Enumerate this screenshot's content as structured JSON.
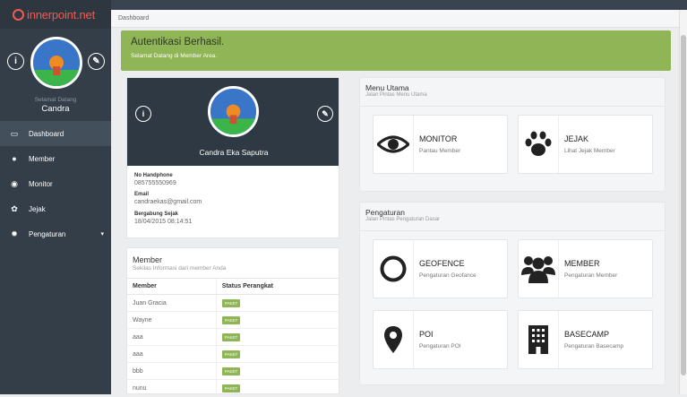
{
  "brand": {
    "name": "innerpoint.net"
  },
  "sidebar": {
    "greeting": "Selamat Datang",
    "username": "Candra",
    "items": [
      {
        "label": "Dashboard",
        "icon": "monitor-icon"
      },
      {
        "label": "Member",
        "icon": "users-icon"
      },
      {
        "label": "Monitor",
        "icon": "eye-icon"
      },
      {
        "label": "Jejak",
        "icon": "paw-icon"
      },
      {
        "label": "Pengaturan",
        "icon": "gear-icon"
      }
    ]
  },
  "breadcrumb": "Dashboard",
  "alert": {
    "title": "Autentikasi Berhasil.",
    "subtitle": "Selamat Datang di Member Area."
  },
  "profile": {
    "name": "Candra Eka Saputra",
    "phone_label": "No Handphone",
    "phone": "085755550969",
    "email_label": "Email",
    "email": "candraekas@gmail.com",
    "joined_label": "Bergabung Sejak",
    "joined": "18/04/2015 08:14:51"
  },
  "member": {
    "title": "Member",
    "subtitle": "Sekilas Informasi dari member Anda",
    "headers": [
      "Member",
      "Status Perangkat"
    ],
    "rows": [
      {
        "name": "Juan Gracia",
        "status": "PAKET"
      },
      {
        "name": "Wayne",
        "status": "PAKET"
      },
      {
        "name": "aaa",
        "status": "PAKET"
      },
      {
        "name": "aaa",
        "status": "PAKET"
      },
      {
        "name": "bbb",
        "status": "PAKET"
      },
      {
        "name": "nunu",
        "status": "PAKET"
      }
    ]
  },
  "menu_utama": {
    "title": "Menu Utama",
    "subtitle": "Jalan Pintas Menu Utama",
    "tiles": [
      {
        "title": "MONITOR",
        "subtitle": "Pantau Member",
        "icon": "eye-icon"
      },
      {
        "title": "JEJAK",
        "subtitle": "Lihat Jejak Member",
        "icon": "paw-icon"
      }
    ]
  },
  "pengaturan": {
    "title": "Pengaturan",
    "subtitle": "Jalan Pintas Pengaturan Dasar",
    "tiles": [
      {
        "title": "GEOFENCE",
        "subtitle": "Pengaturan Geofance",
        "icon": "circle-icon"
      },
      {
        "title": "MEMBER",
        "subtitle": "Pengaturan Member",
        "icon": "users-icon"
      },
      {
        "title": "POI",
        "subtitle": "Pengaturan POI",
        "icon": "map-marker-icon"
      },
      {
        "title": "BASECAMP",
        "subtitle": "Pengaturan Basecamp",
        "icon": "building-icon"
      }
    ]
  },
  "colors": {
    "brand": "#f05a52",
    "sidebar": "#343e48",
    "success": "#8fb556"
  }
}
